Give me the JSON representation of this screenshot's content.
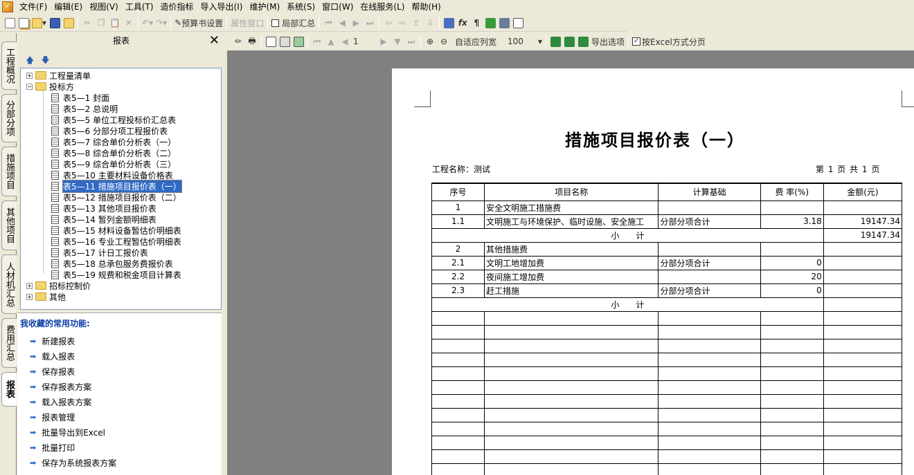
{
  "menu": [
    "文件(F)",
    "编辑(E)",
    "视图(V)",
    "工具(T)",
    "造价指标",
    "导入导出(I)",
    "维护(M)",
    "系统(S)",
    "窗口(W)",
    "在线服务(L)",
    "帮助(H)"
  ],
  "toolbar1": {
    "budget_setting": "预算书设置",
    "property_window": "属性窗口",
    "local_summary": "局部汇总"
  },
  "side_tabs": [
    "工程概况",
    "分部分项",
    "措施项目",
    "其他项目",
    "人材机汇总",
    "费用汇总",
    "报表"
  ],
  "left_panel": {
    "title": "报表",
    "close": "✕"
  },
  "tree": {
    "root1": "工程量清单",
    "root2": "投标方",
    "items": [
      "表5—1 封面",
      "表5—2 总说明",
      "表5—5 单位工程投标价汇总表",
      "表5—6 分部分项工程报价表",
      "表5—7 综合单价分析表（一）",
      "表5—8 综合单价分析表（二）",
      "表5—9 综合单价分析表（三）",
      "表5—10 主要材料设备价格表",
      "表5—11 措施项目报价表（一）",
      "表5—12 措施项目报价表（二）",
      "表5—13 其他项目报价表",
      "表5—14 暂列金额明细表",
      "表5—15 材料设备暂估价明细表",
      "表5—16 专业工程暂估价明细表",
      "表5—17 计日工报价表",
      "表5—18 总承包服务费报价表",
      "表5—19 规费和税金项目计算表"
    ],
    "root3": "招标控制价",
    "root4": "其他"
  },
  "favorites": {
    "title": "我收藏的常用功能:",
    "items": [
      "新建报表",
      "载入报表",
      "保存报表",
      "保存报表方案",
      "载入报表方案",
      "报表管理",
      "批量导出到Excel",
      "批量打印",
      "保存为系统报表方案"
    ]
  },
  "report_toolbar": {
    "page": "1",
    "fit_width": "自适应列宽",
    "zoom": "100",
    "export_options": "导出选项",
    "excel_paging": "按Excel方式分页"
  },
  "report": {
    "title": "措施项目报价表（一）",
    "project": "工程名称：测试",
    "page_info": "第 1 页 共 1 页",
    "headers": [
      "序号",
      "项目名称",
      "计算基础",
      "费 率(%)",
      "金额(元)"
    ],
    "rows": [
      [
        "1",
        "安全文明施工措施费",
        "",
        "",
        ""
      ],
      [
        "1.1",
        "文明施工与环境保护、临时设施、安全施工",
        "分部分项合计",
        "3.18",
        "19147.34"
      ],
      [
        "subtotal",
        "小　　计",
        "",
        "",
        "19147.34"
      ],
      [
        "2",
        "其他措施费",
        "",
        "",
        ""
      ],
      [
        "2.1",
        "文明工地增加费",
        "分部分项合计",
        "0",
        ""
      ],
      [
        "2.2",
        "夜间施工增加费",
        "",
        "20",
        ""
      ],
      [
        "2.3",
        "赶工措施",
        "分部分项合计",
        "0",
        ""
      ],
      [
        "subtotal",
        "小　　计",
        "",
        "",
        ""
      ]
    ]
  }
}
